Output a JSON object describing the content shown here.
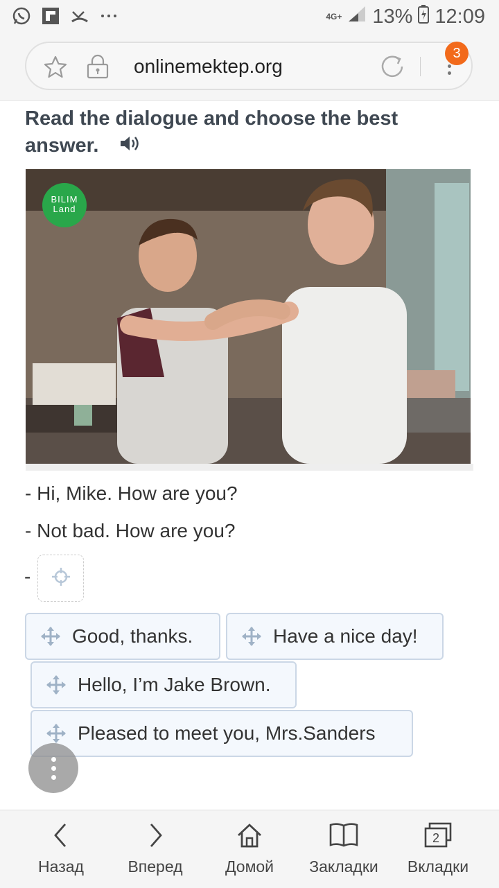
{
  "status_bar": {
    "network": "4G+",
    "battery": "13%",
    "time": "12:09"
  },
  "browser": {
    "url": "onlinemektep.org",
    "tab_badge": "3"
  },
  "lesson": {
    "instruction": "Read the dialogue and choose the best answer.",
    "image_logo": "BILIM Land",
    "dialogue": [
      "- Hi, Mike. How are you?",
      "- Not bad. How are you?"
    ],
    "blank_prefix": "-",
    "options": [
      "Good, thanks.",
      "Have a nice day!",
      "Hello, I’m Jake Brown.",
      "Pleased to meet you, Mrs.Sanders"
    ]
  },
  "bottom_nav": {
    "back": "Назад",
    "forward": "Вперед",
    "home": "Домой",
    "bookmarks": "Закладки",
    "tabs": "Вкладки",
    "tabs_count": "2"
  },
  "colors": {
    "accent_badge": "#f26a1b",
    "chip_border": "#cbd7e6",
    "chip_bg": "#f4f8fd",
    "logo_green": "#29a74a"
  }
}
